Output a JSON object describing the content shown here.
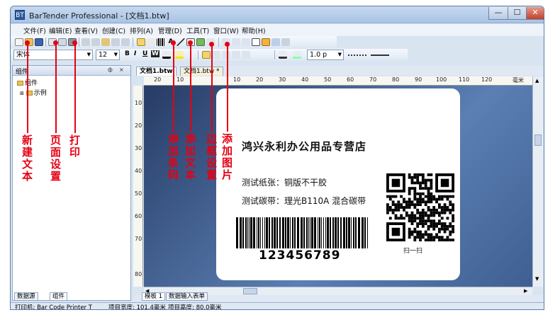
{
  "window": {
    "title": "BarTender Professional - [文档1.btw]",
    "app_icon": "BT",
    "controls": {
      "minimize": "—",
      "maximize": "☐",
      "close": "✕"
    }
  },
  "menu": [
    {
      "label": "文件(F)"
    },
    {
      "label": "编辑(E)"
    },
    {
      "label": "查看(V)"
    },
    {
      "label": "创建(C)"
    },
    {
      "label": "排列(A)"
    },
    {
      "label": "管理(D)"
    },
    {
      "label": "工具(T)"
    },
    {
      "label": "窗口(W)"
    },
    {
      "label": "帮助(H)"
    }
  ],
  "format_toolbar": {
    "font_name": "宋体",
    "font_size": "12",
    "bold": "B",
    "italic": "I",
    "underline": "U",
    "word_art": "W",
    "line_width": "1.0 p"
  },
  "components_panel": {
    "title": "组件",
    "pin": "ф",
    "close": "×",
    "tree": [
      {
        "label": "组件"
      },
      {
        "label": "示例"
      }
    ],
    "tabs": {
      "datasource": "数据源",
      "components": "组件"
    }
  },
  "document_tabs": [
    {
      "label": "文档1.btw"
    },
    {
      "label": "文档1.btw *"
    }
  ],
  "ruler": {
    "h_numbers": [
      "20",
      "10",
      "10",
      "20",
      "30",
      "40",
      "50",
      "60",
      "70",
      "80",
      "90",
      "100",
      "110",
      "120"
    ],
    "h_unit": "毫米",
    "v_numbers": [
      "10",
      "20",
      "30",
      "40",
      "50",
      "60",
      "70",
      "80"
    ]
  },
  "label": {
    "company": "鸿兴永利办公用品专营店",
    "paper": "测试纸张：铜版不干胶",
    "ribbon": "测试碳带：理光B110A 混合碳带",
    "barcode_number": "123456789",
    "qr_caption": "扫一扫"
  },
  "sheet_tabs": [
    {
      "label": "模板 1"
    },
    {
      "label": "数据输入表单"
    }
  ],
  "status": {
    "printer": "打印机: Bar Code Printer T",
    "width": "项目宽度: 101.4毫米",
    "height": "项目高度: 80.0毫米"
  },
  "annotations": [
    {
      "label": "新建文本"
    },
    {
      "label": "页面设置"
    },
    {
      "label": "打印"
    },
    {
      "label": "添加条码"
    },
    {
      "label": "添加文本"
    },
    {
      "label": "边框设置"
    },
    {
      "label": "添加图片"
    }
  ],
  "colors": {
    "annotation": "#e60012",
    "workspace": "#3f5f92"
  }
}
